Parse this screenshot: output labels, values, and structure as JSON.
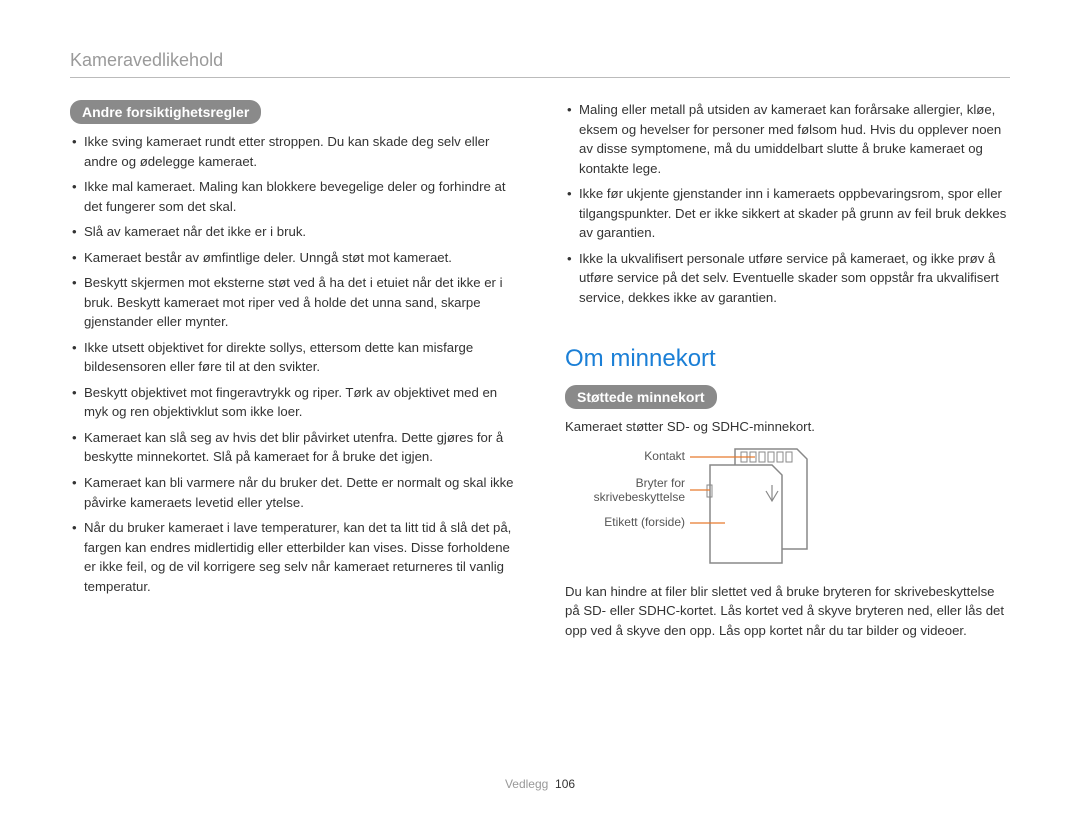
{
  "breadcrumb": "Kameravedlikehold",
  "left": {
    "tag": "Andre forsiktighetsregler",
    "bullets": [
      "Ikke sving kameraet rundt etter stroppen. Du kan skade deg selv eller andre og ødelegge kameraet.",
      "Ikke mal kameraet. Maling kan blokkere bevegelige deler og forhindre at det fungerer som det skal.",
      "Slå av kameraet når det ikke er i bruk.",
      "Kameraet består av ømfintlige deler. Unngå støt mot kameraet.",
      "Beskytt skjermen mot eksterne støt ved å ha det i etuiet når det ikke er i bruk. Beskytt kameraet mot riper ved å holde det unna sand, skarpe gjenstander eller mynter.",
      "Ikke utsett objektivet for direkte sollys, ettersom dette kan misfarge bildesensoren eller føre til at den svikter.",
      "Beskytt objektivet mot fingeravtrykk og riper. Tørk av objektivet med en myk og ren objektivklut som ikke loer.",
      "Kameraet kan slå seg av hvis det blir påvirket utenfra. Dette gjøres for å beskytte minnekortet. Slå på kameraet for å bruke det igjen.",
      "Kameraet kan bli varmere når du bruker det. Dette er normalt og skal ikke påvirke kameraets levetid eller ytelse.",
      "Når du bruker kameraet i lave temperaturer, kan det ta litt tid å slå det på, fargen kan endres midlertidig eller etterbilder kan vises. Disse forholdene er ikke feil, og de vil korrigere seg selv når kameraet returneres til vanlig temperatur."
    ]
  },
  "right": {
    "bullets_top": [
      "Maling eller metall på utsiden av kameraet kan forårsake allergier, kløe, eksem og hevelser for personer med følsom hud. Hvis du opplever noen av disse symptomene, må du umiddelbart slutte å bruke kameraet og kontakte lege.",
      "Ikke før ukjente gjenstander inn i kameraets oppbevaringsrom, spor eller tilgangspunkter. Det er ikke sikkert at skader på grunn av feil bruk dekkes av garantien.",
      "Ikke la ukvalifisert personale utføre service på kameraet, og ikke prøv å utføre service på det selv. Eventuelle skader som oppstår fra ukvalifisert service, dekkes ikke av garantien."
    ],
    "section_title": "Om minnekort",
    "tag2": "Støttede minnekort",
    "support_text": "Kameraet støtter SD- og SDHC-minnekort.",
    "labels": {
      "contact": "Kontakt",
      "switch1": "Bryter for",
      "switch2": "skrivebeskyttelse",
      "label_front": "Etikett (forside)"
    },
    "bottom_text": "Du kan hindre at filer blir slettet ved å bruke bryteren for skrivebeskyttelse på SD- eller SDHC-kortet. Lås kortet ved å skyve bryteren ned, eller lås det opp ved å skyve den opp. Lås opp kortet når du tar bilder og videoer."
  },
  "footer": {
    "section": "Vedlegg",
    "page": "106"
  }
}
